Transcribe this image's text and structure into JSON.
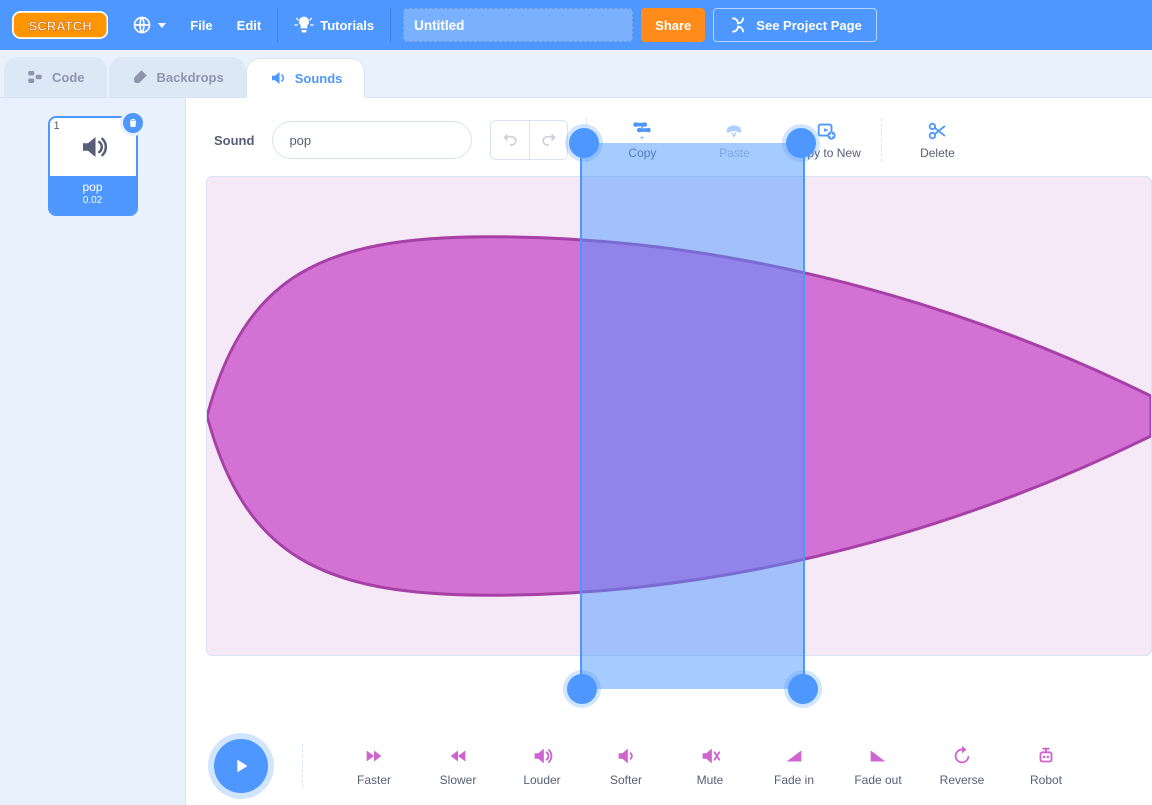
{
  "menubar": {
    "file": "File",
    "edit": "Edit",
    "tutorials": "Tutorials",
    "title_value": "Untitled",
    "share": "Share",
    "see_project": "See Project Page"
  },
  "tabs": {
    "code": "Code",
    "backdrops": "Backdrops",
    "sounds": "Sounds"
  },
  "soundList": {
    "items": [
      {
        "index": "1",
        "name": "pop",
        "duration": "0.02"
      }
    ]
  },
  "editor": {
    "sound_label": "Sound",
    "sound_name": "pop",
    "tools": {
      "copy": "Copy",
      "paste": "Paste",
      "copy_to_new": "Copy to New",
      "delete": "Delete"
    },
    "selection": {
      "start_frac": 0.395,
      "end_frac": 0.634
    }
  },
  "playback": {
    "effects": {
      "faster": "Faster",
      "slower": "Slower",
      "louder": "Louder",
      "softer": "Softer",
      "mute": "Mute",
      "fade_in": "Fade in",
      "fade_out": "Fade out",
      "reverse": "Reverse",
      "robot": "Robot"
    }
  }
}
